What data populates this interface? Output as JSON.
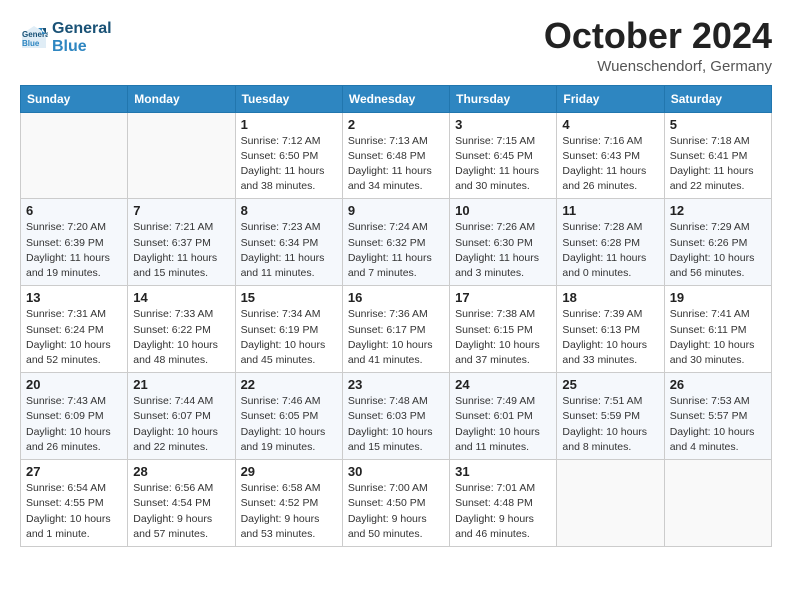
{
  "header": {
    "logo_line1": "General",
    "logo_line2": "Blue",
    "month_title": "October 2024",
    "location": "Wuenschendorf, Germany"
  },
  "weekdays": [
    "Sunday",
    "Monday",
    "Tuesday",
    "Wednesday",
    "Thursday",
    "Friday",
    "Saturday"
  ],
  "weeks": [
    [
      {
        "day": "",
        "info": ""
      },
      {
        "day": "",
        "info": ""
      },
      {
        "day": "1",
        "info": "Sunrise: 7:12 AM\nSunset: 6:50 PM\nDaylight: 11 hours and 38 minutes."
      },
      {
        "day": "2",
        "info": "Sunrise: 7:13 AM\nSunset: 6:48 PM\nDaylight: 11 hours and 34 minutes."
      },
      {
        "day": "3",
        "info": "Sunrise: 7:15 AM\nSunset: 6:45 PM\nDaylight: 11 hours and 30 minutes."
      },
      {
        "day": "4",
        "info": "Sunrise: 7:16 AM\nSunset: 6:43 PM\nDaylight: 11 hours and 26 minutes."
      },
      {
        "day": "5",
        "info": "Sunrise: 7:18 AM\nSunset: 6:41 PM\nDaylight: 11 hours and 22 minutes."
      }
    ],
    [
      {
        "day": "6",
        "info": "Sunrise: 7:20 AM\nSunset: 6:39 PM\nDaylight: 11 hours and 19 minutes."
      },
      {
        "day": "7",
        "info": "Sunrise: 7:21 AM\nSunset: 6:37 PM\nDaylight: 11 hours and 15 minutes."
      },
      {
        "day": "8",
        "info": "Sunrise: 7:23 AM\nSunset: 6:34 PM\nDaylight: 11 hours and 11 minutes."
      },
      {
        "day": "9",
        "info": "Sunrise: 7:24 AM\nSunset: 6:32 PM\nDaylight: 11 hours and 7 minutes."
      },
      {
        "day": "10",
        "info": "Sunrise: 7:26 AM\nSunset: 6:30 PM\nDaylight: 11 hours and 3 minutes."
      },
      {
        "day": "11",
        "info": "Sunrise: 7:28 AM\nSunset: 6:28 PM\nDaylight: 11 hours and 0 minutes."
      },
      {
        "day": "12",
        "info": "Sunrise: 7:29 AM\nSunset: 6:26 PM\nDaylight: 10 hours and 56 minutes."
      }
    ],
    [
      {
        "day": "13",
        "info": "Sunrise: 7:31 AM\nSunset: 6:24 PM\nDaylight: 10 hours and 52 minutes."
      },
      {
        "day": "14",
        "info": "Sunrise: 7:33 AM\nSunset: 6:22 PM\nDaylight: 10 hours and 48 minutes."
      },
      {
        "day": "15",
        "info": "Sunrise: 7:34 AM\nSunset: 6:19 PM\nDaylight: 10 hours and 45 minutes."
      },
      {
        "day": "16",
        "info": "Sunrise: 7:36 AM\nSunset: 6:17 PM\nDaylight: 10 hours and 41 minutes."
      },
      {
        "day": "17",
        "info": "Sunrise: 7:38 AM\nSunset: 6:15 PM\nDaylight: 10 hours and 37 minutes."
      },
      {
        "day": "18",
        "info": "Sunrise: 7:39 AM\nSunset: 6:13 PM\nDaylight: 10 hours and 33 minutes."
      },
      {
        "day": "19",
        "info": "Sunrise: 7:41 AM\nSunset: 6:11 PM\nDaylight: 10 hours and 30 minutes."
      }
    ],
    [
      {
        "day": "20",
        "info": "Sunrise: 7:43 AM\nSunset: 6:09 PM\nDaylight: 10 hours and 26 minutes."
      },
      {
        "day": "21",
        "info": "Sunrise: 7:44 AM\nSunset: 6:07 PM\nDaylight: 10 hours and 22 minutes."
      },
      {
        "day": "22",
        "info": "Sunrise: 7:46 AM\nSunset: 6:05 PM\nDaylight: 10 hours and 19 minutes."
      },
      {
        "day": "23",
        "info": "Sunrise: 7:48 AM\nSunset: 6:03 PM\nDaylight: 10 hours and 15 minutes."
      },
      {
        "day": "24",
        "info": "Sunrise: 7:49 AM\nSunset: 6:01 PM\nDaylight: 10 hours and 11 minutes."
      },
      {
        "day": "25",
        "info": "Sunrise: 7:51 AM\nSunset: 5:59 PM\nDaylight: 10 hours and 8 minutes."
      },
      {
        "day": "26",
        "info": "Sunrise: 7:53 AM\nSunset: 5:57 PM\nDaylight: 10 hours and 4 minutes."
      }
    ],
    [
      {
        "day": "27",
        "info": "Sunrise: 6:54 AM\nSunset: 4:55 PM\nDaylight: 10 hours and 1 minute."
      },
      {
        "day": "28",
        "info": "Sunrise: 6:56 AM\nSunset: 4:54 PM\nDaylight: 9 hours and 57 minutes."
      },
      {
        "day": "29",
        "info": "Sunrise: 6:58 AM\nSunset: 4:52 PM\nDaylight: 9 hours and 53 minutes."
      },
      {
        "day": "30",
        "info": "Sunrise: 7:00 AM\nSunset: 4:50 PM\nDaylight: 9 hours and 50 minutes."
      },
      {
        "day": "31",
        "info": "Sunrise: 7:01 AM\nSunset: 4:48 PM\nDaylight: 9 hours and 46 minutes."
      },
      {
        "day": "",
        "info": ""
      },
      {
        "day": "",
        "info": ""
      }
    ]
  ]
}
